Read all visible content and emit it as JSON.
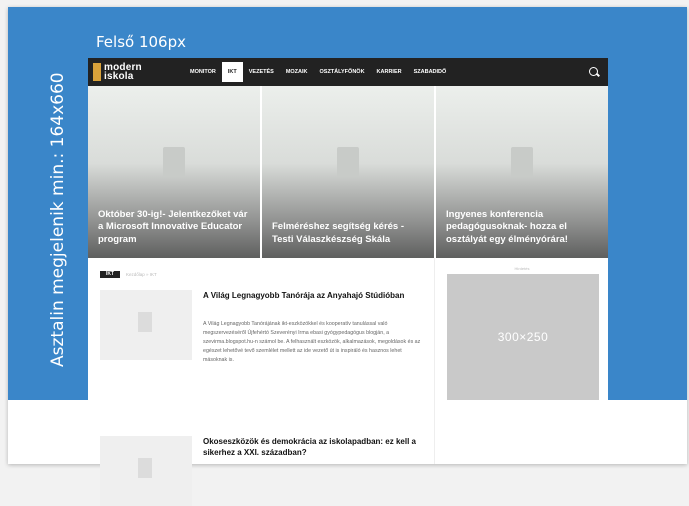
{
  "annotation": {
    "side_label": "Asztalin megjelenik min.: 164x660",
    "top_label": "Felső 106px"
  },
  "logo": {
    "line1": "modern",
    "line2": "iskola"
  },
  "nav": {
    "items": [
      "MONITOR",
      "IKT",
      "VEZETÉS",
      "MOZAIK",
      "OSZTÁLYFŐNÖK",
      "KARRIER",
      "SZABADIDŐ"
    ],
    "active": "IKT"
  },
  "heroes": [
    {
      "title": "Október 30-ig!- Jelentkezőket vár a Microsoft Innovative Educator program"
    },
    {
      "title": "Felméréshez segítség kérés - Testi Válaszkészség Skála"
    },
    {
      "title": "Ingyenes konferencia pedagógusoknak- hozza el osztályát egy élményórára!"
    }
  ],
  "breadcrumb": {
    "badge": "IKT",
    "path": "Kezdőlap  »  IKT"
  },
  "articles": [
    {
      "title": "A Világ Legnagyobb Tanórája az Anyahajó Stúdióban",
      "excerpt": "A Világ Legnagyobb Tanórájának ikt-eszközökkel és kooperatív tanulással való megszervezéséről Újfehértó Szeverényi Irma ebasi gyógypedagógus blogján, a szevirma.blogspot.hu-n számol be. A felhasznált eszközök, alkalmazások, megoldások és az egészet lehetővé tevő szemlélet mellett az ide vezető út is inspiráló és hasznos lehet másoknak is."
    },
    {
      "title": "Okoseszközök és demokrácia az iskolapadban: ez kell a sikerhez a XXI. században?",
      "excerpt": ""
    }
  ],
  "sidebar": {
    "ad_label": "Hirdetés",
    "ad_size": "300×250"
  }
}
